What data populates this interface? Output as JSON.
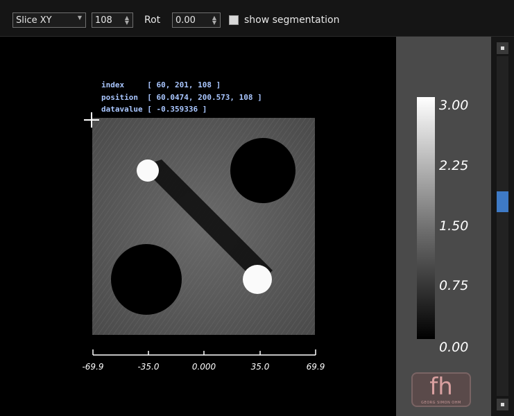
{
  "toolbar": {
    "view_mode": "Slice XY",
    "slice_index": "108",
    "rot_label": "Rot",
    "rot_value": "0.00",
    "segmentation_label": "show segmentation",
    "segmentation_checked": false
  },
  "info": {
    "index_line": "index     [ 60, 201, 108 ]",
    "position_line": "position  [ 60.0474, 200.573, 108 ]",
    "datavalue_line": "datavalue [ -0.359336 ]"
  },
  "axis": {
    "ticks": [
      "-69.9",
      "-35.0",
      "0.000",
      "35.0",
      "69.9"
    ]
  },
  "colorbar": {
    "labels": [
      "3.00",
      "2.25",
      "1.50",
      "0.75",
      "0.00"
    ],
    "gradient": [
      "#ffffff",
      "#000000"
    ]
  },
  "logo": {
    "text": "fh",
    "subtext": "GEORG SIMON OHM"
  },
  "scrollbar": {
    "position_fraction": 0.43
  },
  "colors": {
    "accent": "#3e7ac6",
    "info_text": "#a9c6ff",
    "panel": "#4a4a4a"
  }
}
